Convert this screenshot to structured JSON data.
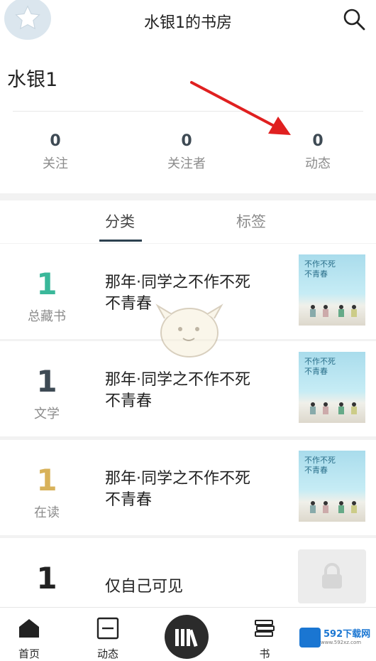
{
  "header": {
    "title": "水银1的书房",
    "username": "水银1"
  },
  "stats": [
    {
      "value": "0",
      "label": "关注"
    },
    {
      "value": "0",
      "label": "关注者"
    },
    {
      "value": "0",
      "label": "动态"
    }
  ],
  "tabs": [
    {
      "label": "分类",
      "active": true
    },
    {
      "label": "标签",
      "active": false
    }
  ],
  "shelves": [
    {
      "count": "1",
      "label": "总藏书",
      "title": "那年·同学之不作不死不青春",
      "count_color": "#3ab89a"
    },
    {
      "count": "1",
      "label": "文学",
      "title": "那年·同学之不作不死不青春",
      "count_color": "#3e4a54"
    },
    {
      "count": "1",
      "label": "在读",
      "title": "那年·同学之不作不死不青春",
      "count_color": "#d8b25a"
    },
    {
      "count": "1",
      "label": "",
      "title": "仅自己可见",
      "count_color": "#222222"
    }
  ],
  "cover": {
    "text_line1": "不作不死",
    "text_line2": "不青春"
  },
  "bottom_nav": [
    {
      "label": "首页",
      "icon": "home-icon"
    },
    {
      "label": "动态",
      "icon": "feed-icon"
    },
    {
      "label": "",
      "icon": "bookshelf-icon"
    },
    {
      "label": "书",
      "icon": "book-stack-icon"
    }
  ],
  "watermark": {
    "text": "592下载网",
    "sub": "www.592xz.com"
  },
  "colors": {
    "accent_dark": "#2d4150",
    "arrow": "#e02020",
    "stat_number": "#3e4a54"
  }
}
